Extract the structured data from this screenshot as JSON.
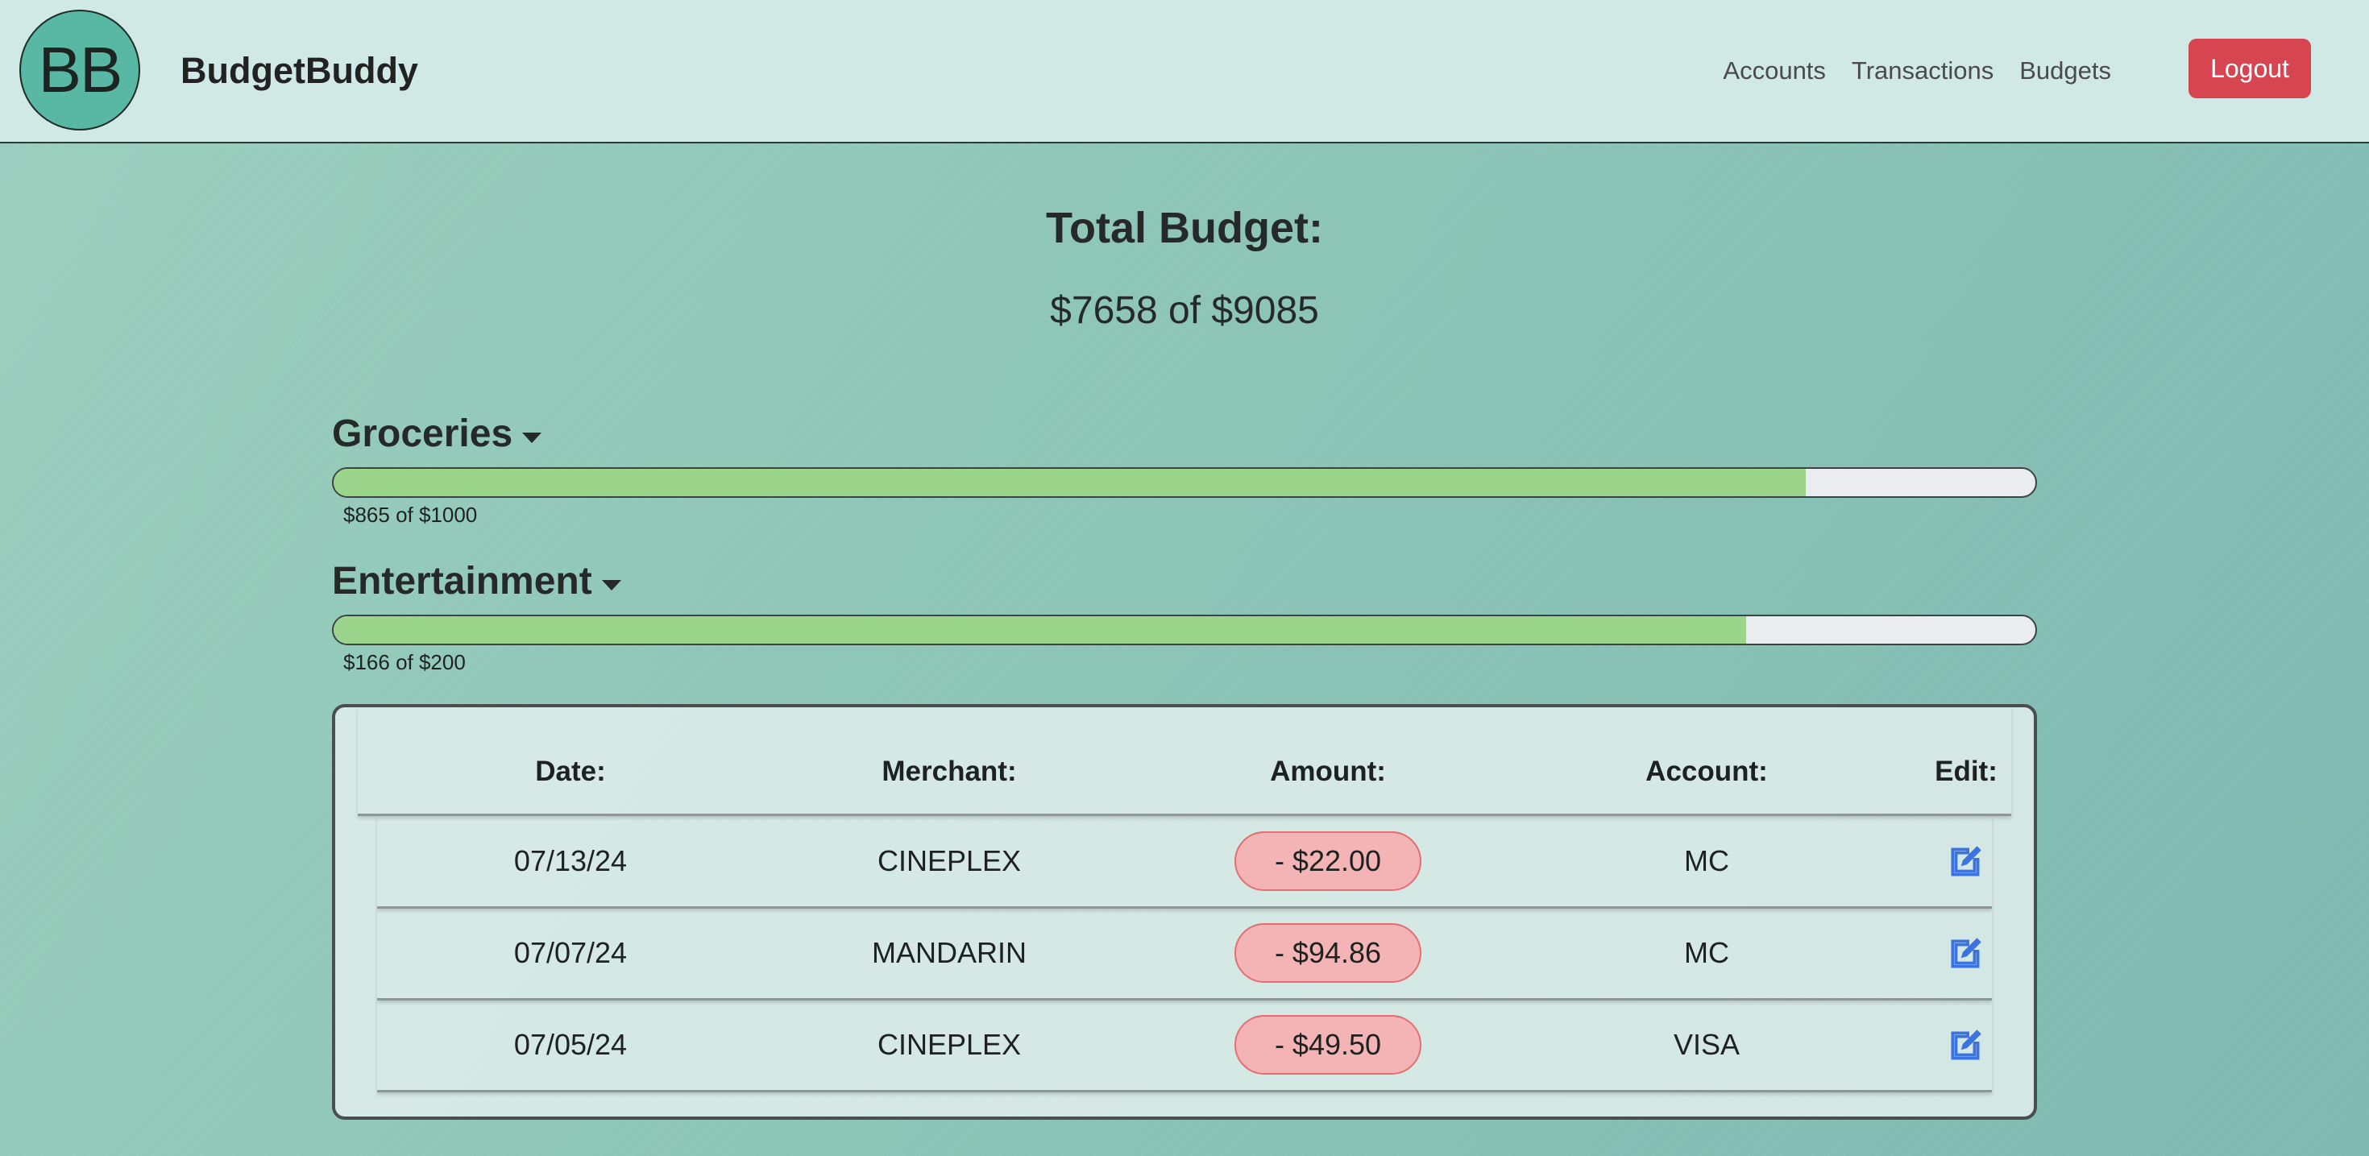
{
  "header": {
    "logo_text": "BB",
    "brand": "BudgetBuddy",
    "nav": [
      {
        "label": "Accounts"
      },
      {
        "label": "Transactions"
      },
      {
        "label": "Budgets"
      }
    ],
    "logout_label": "Logout",
    "logout_color": "#d64550"
  },
  "total": {
    "title": "Total Budget:",
    "amount_text": "$7658 of $9085",
    "spent": 7658,
    "limit": 9085
  },
  "budgets": [
    {
      "name": "Groceries",
      "spent": 865,
      "limit": 1000,
      "label": "$865 of $1000",
      "fill_percent": 86.5
    },
    {
      "name": "Entertainment",
      "spent": 166,
      "limit": 200,
      "label": "$166 of $200",
      "fill_percent": 83
    }
  ],
  "transactions": {
    "headers": {
      "date": "Date:",
      "merchant": "Merchant:",
      "amount": "Amount:",
      "account": "Account:",
      "edit": "Edit:"
    },
    "rows": [
      {
        "date": "07/13/24",
        "merchant": "CINEPLEX",
        "amount": "- $22.00",
        "account": "MC",
        "edit_icon": "edit-icon"
      },
      {
        "date": "07/07/24",
        "merchant": "MANDARIN",
        "amount": "- $94.86",
        "account": "MC",
        "edit_icon": "edit-icon"
      },
      {
        "date": "07/05/24",
        "merchant": "CINEPLEX",
        "amount": "- $49.50",
        "account": "VISA",
        "edit_icon": "edit-icon"
      }
    ]
  },
  "colors": {
    "progress_fill": "#9bd48b",
    "progress_track": "#ebecef",
    "amount_pill": "#f4b4b6",
    "edit_icon": "#3b73e0"
  }
}
